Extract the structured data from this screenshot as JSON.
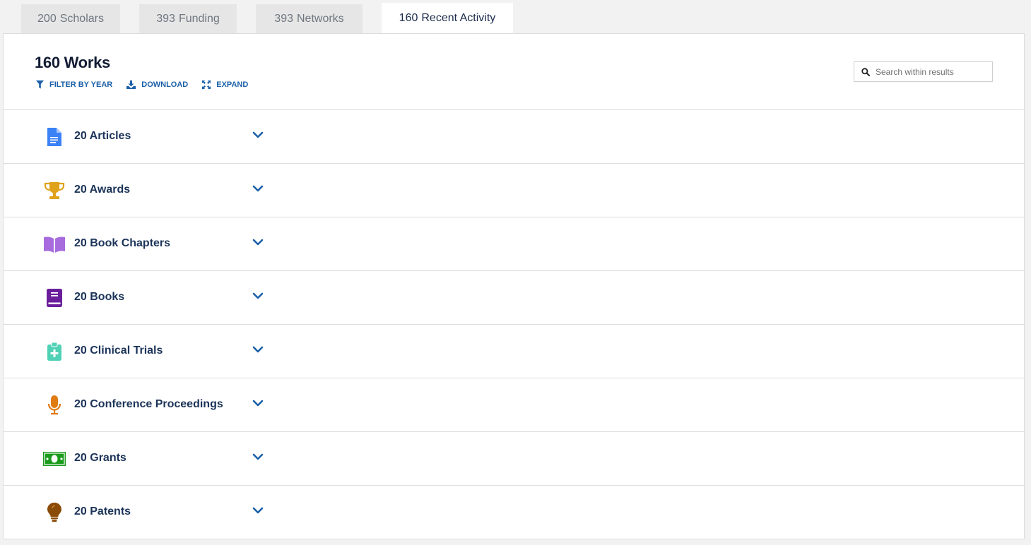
{
  "tabs": [
    {
      "count": "200",
      "label": "Scholars",
      "active": false
    },
    {
      "count": "393",
      "label": "Funding",
      "active": false
    },
    {
      "count": "393",
      "label": "Networks",
      "active": false
    },
    {
      "count": "160",
      "label": "Recent Activity",
      "active": true
    }
  ],
  "header": {
    "title": "160 Works",
    "actions": {
      "filter": "FILTER BY YEAR",
      "download": "DOWNLOAD",
      "expand": "EXPAND"
    },
    "search_placeholder": "Search within results"
  },
  "rows": [
    {
      "label": "20 Articles",
      "icon": "document-icon",
      "color": "#3b82f6"
    },
    {
      "label": "20 Awards",
      "icon": "trophy-icon",
      "color": "#e0a21b"
    },
    {
      "label": "20 Book Chapters",
      "icon": "open-book-icon",
      "color": "#a86bde"
    },
    {
      "label": "20 Books",
      "icon": "book-icon",
      "color": "#6b1e9c"
    },
    {
      "label": "20 Clinical Trials",
      "icon": "clipboard-medical-icon",
      "color": "#4fd1b5"
    },
    {
      "label": "20 Conference Proceedings",
      "icon": "microphone-icon",
      "color": "#e07b12"
    },
    {
      "label": "20 Grants",
      "icon": "money-icon",
      "color": "#1a9a1a"
    },
    {
      "label": "20 Patents",
      "icon": "lightbulb-icon",
      "color": "#8a4b08"
    }
  ],
  "colors": {
    "accent": "#1a5fa8",
    "label": "#1b3358"
  }
}
